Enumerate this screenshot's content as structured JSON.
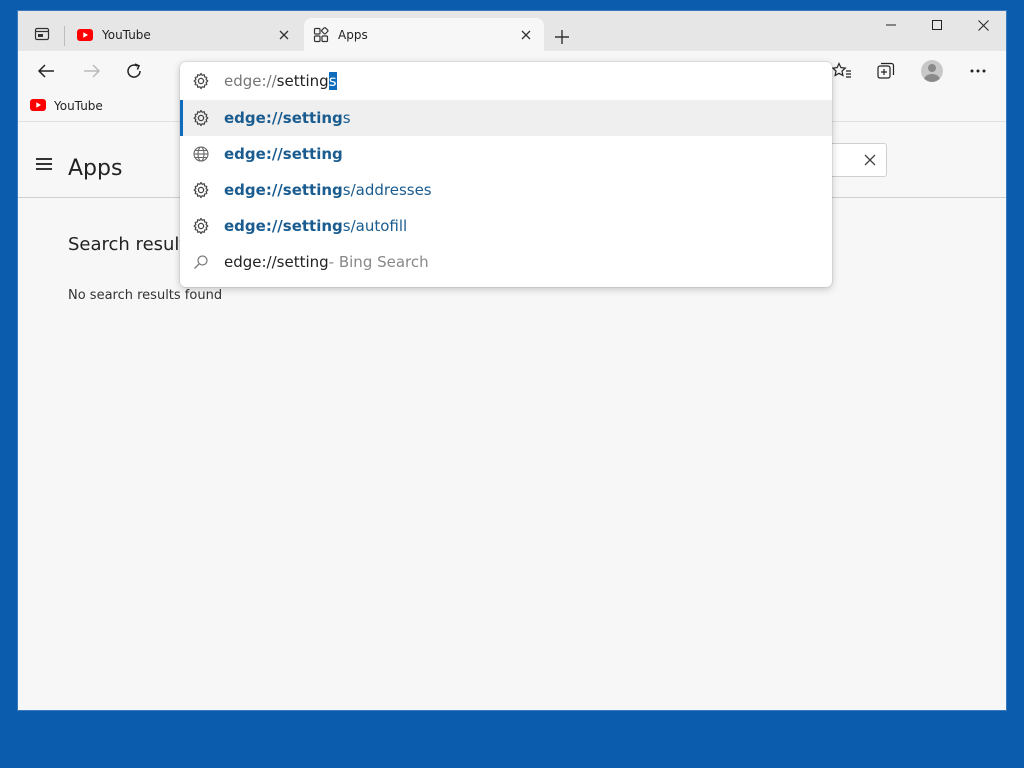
{
  "tabs": [
    {
      "title": "YouTube",
      "icon": "youtube-icon",
      "active": false
    },
    {
      "title": "Apps",
      "icon": "apps-icon",
      "active": true
    }
  ],
  "bookmarks": [
    {
      "label": "YouTube",
      "icon": "youtube-icon"
    }
  ],
  "omnibox": {
    "text_before": "edge://",
    "text_typed": "setting",
    "text_selected": "s"
  },
  "suggestions": [
    {
      "icon": "gear-icon",
      "match": "edge://setting",
      "rest": "s",
      "highlighted": true
    },
    {
      "icon": "globe-icon",
      "match": "edge://setting",
      "rest": "",
      "highlighted": false
    },
    {
      "icon": "gear-icon",
      "match": "edge://setting",
      "rest": "s/addresses",
      "highlighted": false
    },
    {
      "icon": "gear-icon",
      "match": "edge://setting",
      "rest": "s/autofill",
      "highlighted": false
    },
    {
      "icon": "search-icon",
      "query": "edge://setting",
      "description": " - Bing Search",
      "highlighted": false
    }
  ],
  "page": {
    "title": "Apps",
    "results_heading": "Search results",
    "empty_message": "No search results found"
  },
  "colors": {
    "desktop": "#0b5cad",
    "accent": "#0f6cbd",
    "match_text": "#1a5c8f",
    "youtube_red": "#ff0000"
  }
}
